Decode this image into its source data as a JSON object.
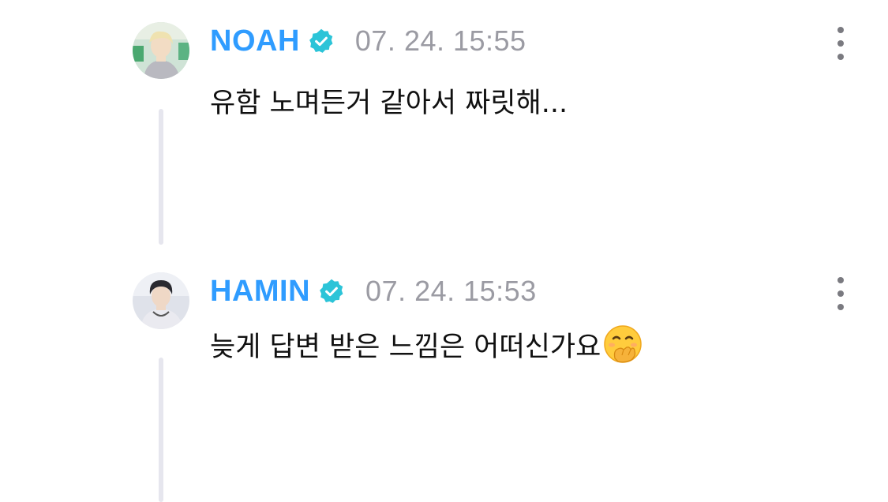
{
  "comments": [
    {
      "username": "NOAH",
      "verified_icon": "verified-check-icon",
      "timestamp": "07. 24. 15:55",
      "text": "유함 노며든거 같아서 짜릿해...",
      "more_icon": "more-vertical-icon"
    },
    {
      "username": "HAMIN",
      "verified_icon": "verified-check-icon",
      "timestamp": "07. 24. 15:53",
      "text": "늦게 답변 받은 느낌은 어떠신가요",
      "emoji_icon": "hand-over-mouth-emoji-icon",
      "more_icon": "more-vertical-icon"
    }
  ],
  "colors": {
    "username": "#2f9cff",
    "verified_badge": "#2cc4d8",
    "timestamp": "#9b9ba3",
    "thread_line": "#e6e6ee",
    "text": "#111111"
  }
}
